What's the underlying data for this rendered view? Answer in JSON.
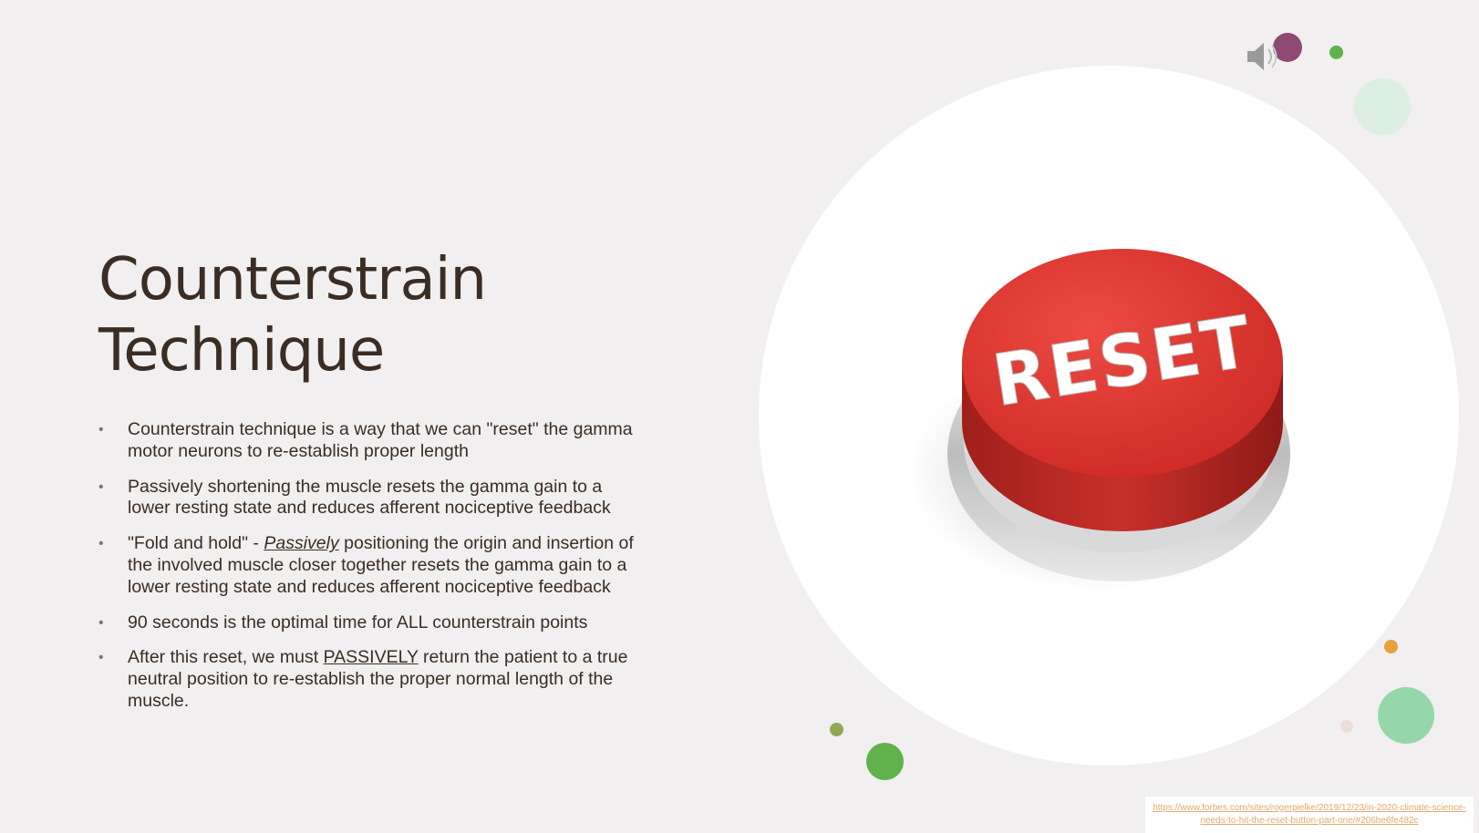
{
  "slide": {
    "title_line1": "Counterstrain",
    "title_line2": "Technique",
    "bullet_marker": "•",
    "bullets": [
      {
        "text": "Counterstrain technique is a way that we can \"reset\" the gamma motor neurons to re-establish proper length"
      },
      {
        "text": "Passively shortening the muscle resets the gamma gain to a lower resting state and reduces afferent nociceptive feedback"
      },
      {
        "before": "\"Fold and hold\" - ",
        "emph": "Passively",
        "after": " positioning the origin and insertion of the involved muscle closer together  resets the gamma gain to a lower resting state and reduces afferent nociceptive feedback"
      },
      {
        "text": "90 seconds is the optimal time for ALL counterstrain points"
      },
      {
        "before": "After this reset, we must ",
        "emph": "PASSIVELY",
        "after": " return the patient to a true neutral position to re-establish the proper normal length of the muscle."
      }
    ],
    "image_label": "RESET",
    "source_link": "https://www.forbes.com/sites/rogerpielke/2019/12/23/in-2020-climate-science-needs-to-hit-the-reset-button-part-one/#206be6fe482c"
  },
  "colors": {
    "background": "#f1efef",
    "title": "#3b2d24",
    "button_red": "#d8322c",
    "accent_purple": "#8e4a72",
    "accent_green": "#5fb24c",
    "accent_light_green": "#dcefe2",
    "accent_orange": "#e9a13a",
    "accent_olive": "#93a850",
    "link": "#e7a86c"
  },
  "icons": [
    "speaker-icon"
  ]
}
